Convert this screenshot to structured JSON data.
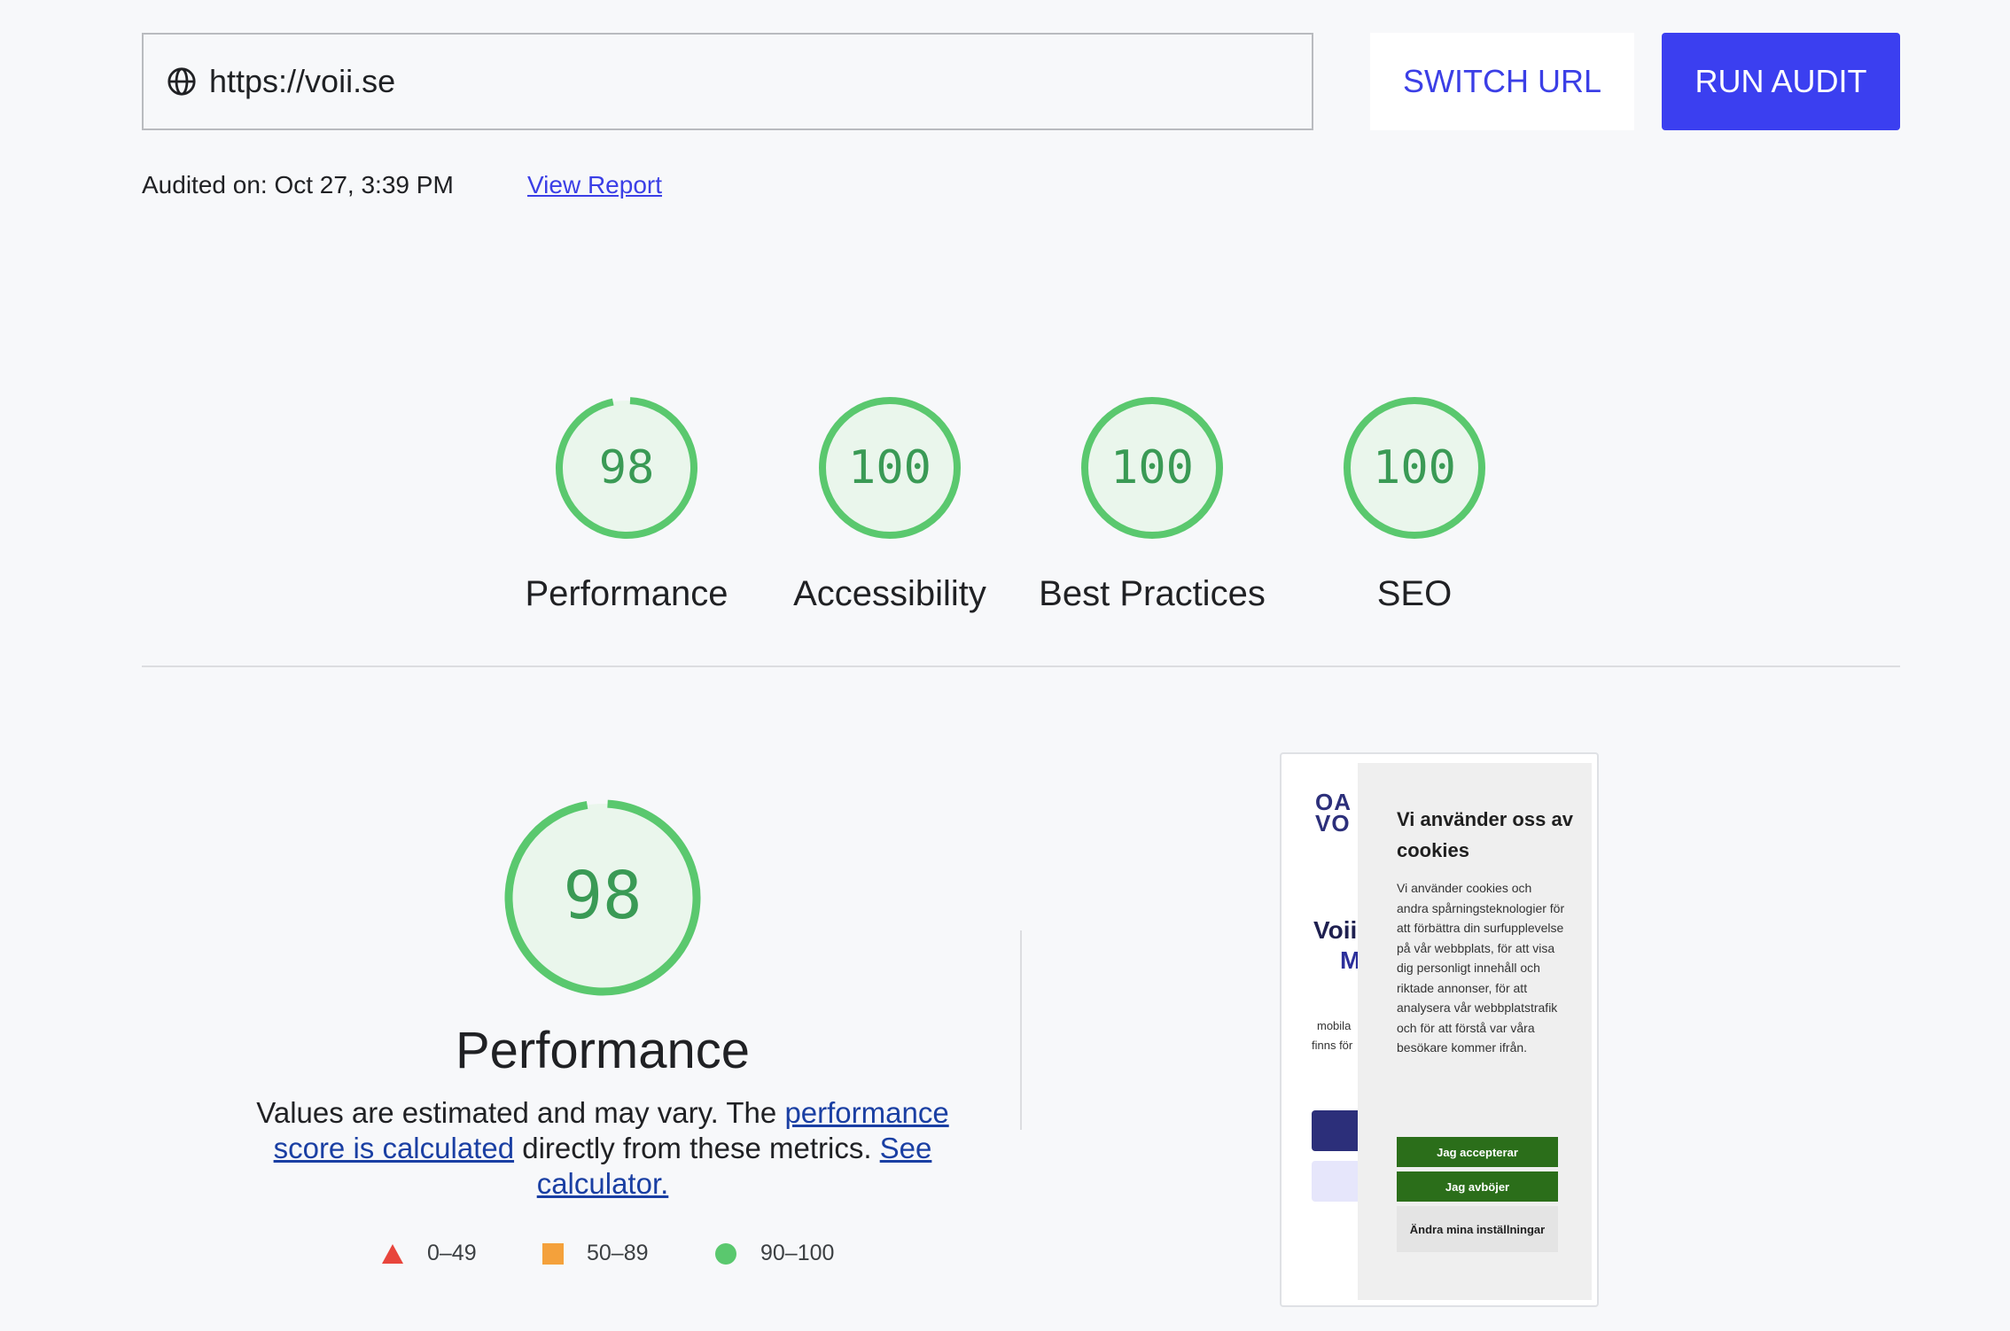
{
  "url_bar": {
    "url": "https://voii.se",
    "globe_icon": "globe-icon"
  },
  "buttons": {
    "switch_url": "SWITCH URL",
    "run_audit": "RUN AUDIT"
  },
  "audit_meta": {
    "audited_on": "Audited on: Oct 27, 3:39 PM",
    "view_report": "View Report"
  },
  "scores": [
    {
      "value": 98,
      "label": "Performance"
    },
    {
      "value": 100,
      "label": "Accessibility"
    },
    {
      "value": 100,
      "label": "Best Practices"
    },
    {
      "value": 100,
      "label": "SEO"
    }
  ],
  "performance_section": {
    "score": 98,
    "title": "Performance",
    "desc_prefix": "Values are estimated and may vary. The ",
    "link_score": "performance score is calculated",
    "desc_middle": " directly from these metrics. ",
    "link_calc": "See calculator.",
    "legend": [
      {
        "shape": "triangle",
        "range": "0–49",
        "color": "#e8453c"
      },
      {
        "shape": "square",
        "range": "50–89",
        "color": "#f4a13b"
      },
      {
        "shape": "circle",
        "range": "90–100",
        "color": "#5ac86e"
      }
    ]
  },
  "screenshot": {
    "logo": "OA VO",
    "heading": "Voii",
    "heading_sub": "M",
    "small_text_1": "mobila",
    "small_text_2": "finns för",
    "cookie_title": "Vi använder oss av cookies",
    "cookie_text": "Vi använder cookies och andra spårningsteknologier för att förbättra din surfupplevelse på vår webbplats, för att visa dig personligt innehåll och riktade annonser, för att analysera vår webbplatstrafik och för att förstå var våra besökare kommer ifrån.",
    "accept": "Jag accepterar",
    "decline": "Jag avböjer",
    "settings": "Ändra mina inställningar"
  },
  "colors": {
    "accent": "#3b3ff0",
    "pass_green": "#5ac86e",
    "pass_text": "#3a9a55",
    "gauge_fill": "#eaf6ec"
  }
}
